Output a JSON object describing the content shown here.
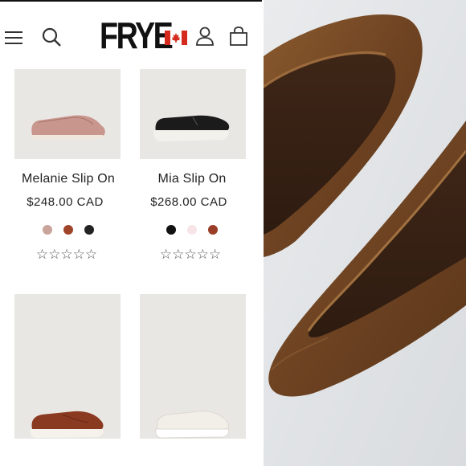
{
  "brand": {
    "logo_text": "FRYE"
  },
  "header": {
    "icons": [
      "hamburger-icon",
      "search-icon",
      "canada-flag-icon",
      "account-icon",
      "shopping-bag-icon"
    ]
  },
  "products": [
    {
      "name": "Melanie Slip On",
      "price": "$248.00 CAD",
      "swatches": [
        "#c9a49a",
        "#a0452a",
        "#222222"
      ],
      "rating_stars": "☆☆☆☆☆"
    },
    {
      "name": "Mia Slip On",
      "price": "$268.00 CAD",
      "swatches": [
        "#111111",
        "#f7e4e6",
        "#9b3e27"
      ],
      "rating_stars": "☆☆☆☆☆"
    },
    {
      "shoe_color": "#8a3a20"
    },
    {
      "shoe_color": "#f2efe9"
    }
  ],
  "colors": {
    "tile_bg": "#e9e7e4",
    "leather_brown": "#7a4a22",
    "photo_bg": "#e6e8ea"
  }
}
